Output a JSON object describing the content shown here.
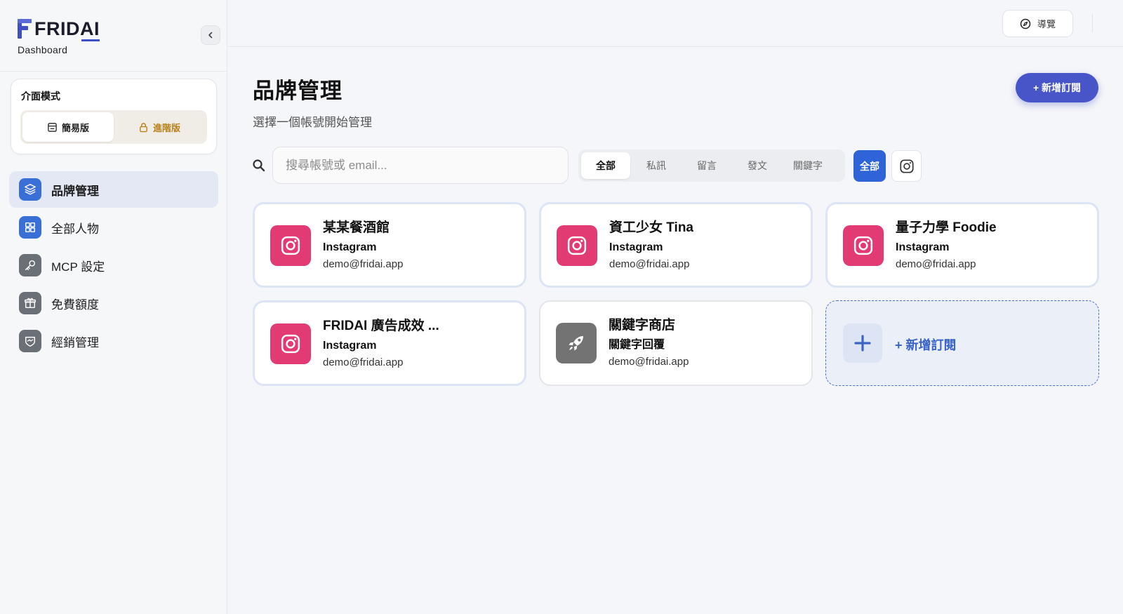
{
  "sidebar": {
    "brand": {
      "logo_text": "FRIDAI",
      "subtitle": "Dashboard"
    },
    "mode": {
      "title": "介面模式",
      "options": [
        {
          "label": "簡易版",
          "icon": "form-icon",
          "active": true
        },
        {
          "label": "進階版",
          "icon": "lock-icon",
          "locked": true
        }
      ]
    },
    "items": [
      {
        "label": "品牌管理",
        "icon": "layers-icon",
        "active": true
      },
      {
        "label": "全部人物",
        "icon": "grid-icon"
      },
      {
        "label": "MCP 設定",
        "icon": "key-icon"
      },
      {
        "label": "免費額度",
        "icon": "gift-icon"
      },
      {
        "label": "經銷管理",
        "icon": "handshake-icon"
      }
    ]
  },
  "topbar": {
    "guide_label": "導覽"
  },
  "main": {
    "title": "品牌管理",
    "subtitle": "選擇一個帳號開始管理",
    "add_button": "+ 新增訂閱",
    "search": {
      "placeholder": "搜尋帳號或 email...",
      "value": ""
    },
    "filter_tabs": [
      {
        "label": "全部",
        "active": true
      },
      {
        "label": "私訊"
      },
      {
        "label": "留言"
      },
      {
        "label": "發文"
      },
      {
        "label": "關鍵字"
      }
    ],
    "platform_filter": {
      "all_label": "全部",
      "instagram_icon": "instagram-icon"
    },
    "cards": [
      {
        "name": "某某餐酒館",
        "platform": "Instagram",
        "email": "demo@fridai.app",
        "icon": "instagram-icon"
      },
      {
        "name": "資工少女 Tina",
        "platform": "Instagram",
        "email": "demo@fridai.app",
        "icon": "instagram-icon"
      },
      {
        "name": "量子力學 Foodie",
        "platform": "Instagram",
        "email": "demo@fridai.app",
        "icon": "instagram-icon"
      },
      {
        "name": "FRIDAI 廣告成效 ...",
        "platform": "Instagram",
        "email": "demo@fridai.app",
        "icon": "instagram-icon"
      },
      {
        "name": "關鍵字商店",
        "platform": "關鍵字回覆",
        "email": "demo@fridai.app",
        "icon": "rocket-icon"
      }
    ],
    "add_card_label": "+ 新增訂閱"
  },
  "colors": {
    "primary": "#4755c9",
    "active_blue": "#2f63d8",
    "instagram": "#e23a73",
    "locked_gold": "#b9801b"
  }
}
